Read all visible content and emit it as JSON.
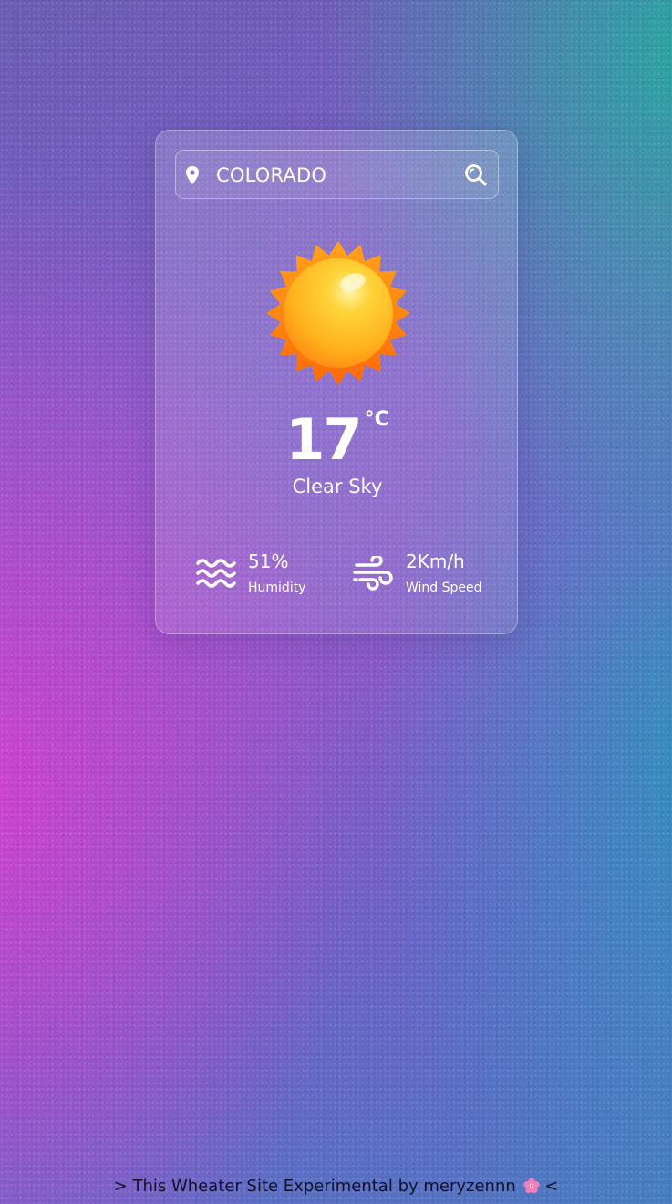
{
  "search": {
    "value": "COLORADO",
    "location_icon": "map-pin-icon",
    "button_icon": "magnifier-icon"
  },
  "weather": {
    "icon": "sun-icon",
    "temperature": "17",
    "unit": "°C",
    "description": "Clear Sky"
  },
  "details": {
    "humidity": {
      "value": "51%",
      "label": "Humidity",
      "icon": "water-waves-icon"
    },
    "wind": {
      "value": "2Km/h",
      "label": "Wind Speed",
      "icon": "wind-icon"
    }
  },
  "footer": {
    "text_before": "> This Wheater Site Experimental by meryzennn",
    "flower_icon": "cherry-blossom-icon",
    "text_after": " <"
  },
  "colors": {
    "text": "#ffffff",
    "sun_core": "#ffc62a",
    "sun_rays": "#ff7e10",
    "footer_text": "#14102a"
  }
}
